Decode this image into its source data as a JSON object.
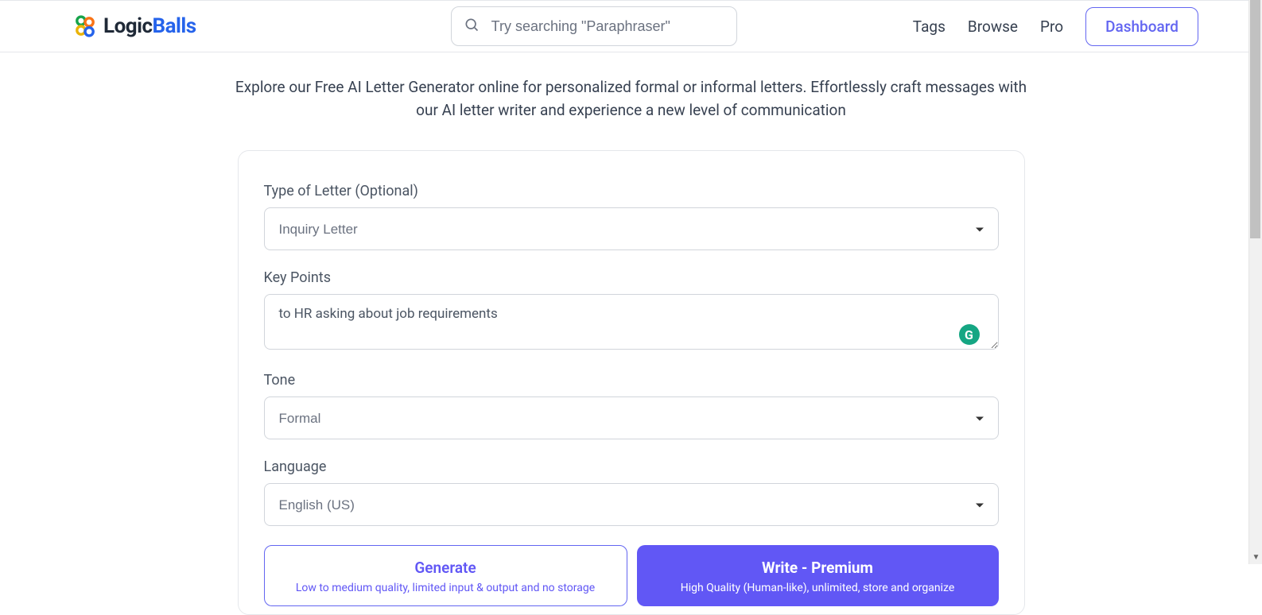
{
  "header": {
    "logo_part1": "Logic",
    "logo_part2": "Balls",
    "search_placeholder": "Try searching \"Paraphraser\"",
    "nav": {
      "tags": "Tags",
      "browse": "Browse",
      "pro": "Pro",
      "dashboard": "Dashboard"
    }
  },
  "intro": "Explore our Free AI Letter Generator online for personalized formal or informal letters. Effortlessly craft messages with our AI letter writer and experience a new level of communication",
  "form": {
    "type_label": "Type of Letter (Optional)",
    "type_value": "Inquiry Letter",
    "keypoints_label": "Key Points",
    "keypoints_value": "to HR asking about job requirements",
    "tone_label": "Tone",
    "tone_value": "Formal",
    "language_label": "Language",
    "language_value": "English (US)"
  },
  "buttons": {
    "generate_title": "Generate",
    "generate_sub": "Low to medium quality, limited input & output and no storage",
    "premium_title": "Write - Premium",
    "premium_sub": "High Quality (Human-like), unlimited, store and organize"
  },
  "grammarly_letter": "G"
}
